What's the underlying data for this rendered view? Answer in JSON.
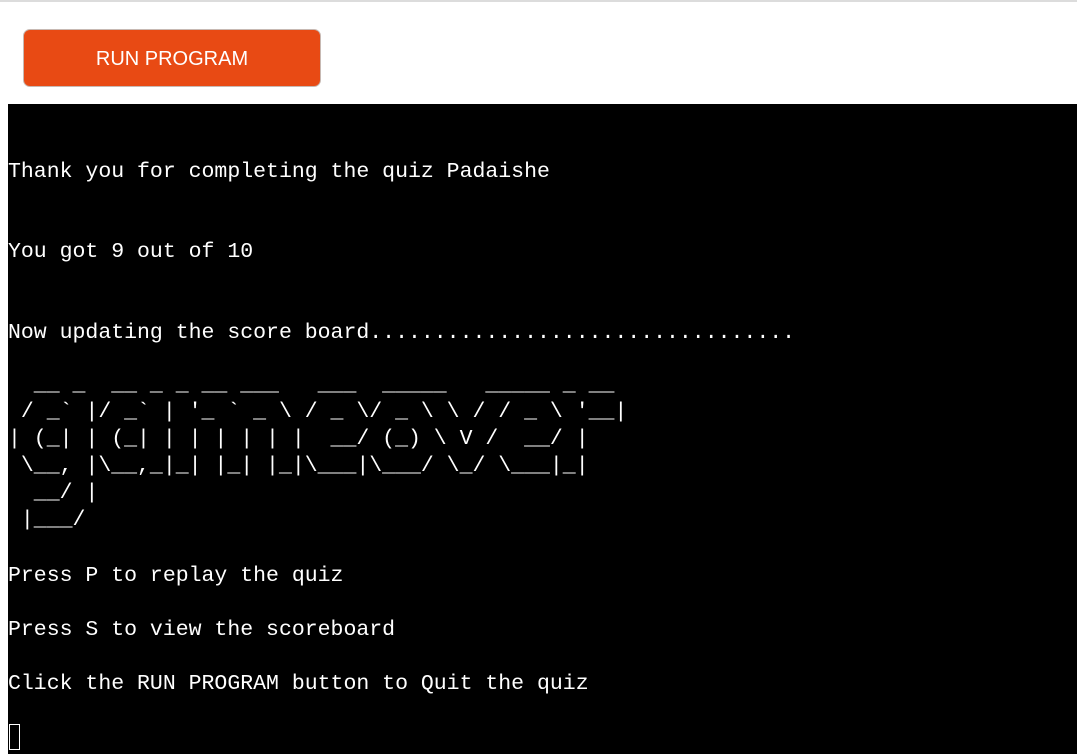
{
  "toolbar": {
    "run_label": "RUN PROGRAM"
  },
  "terminal": {
    "lines": [
      "Thank you for completing the quiz Padaishe",
      "You got 9 out of 10",
      "Now updating the score board................................."
    ],
    "ascii_art": "  __ _  __ _ _ __ ___   ___  _____   _____ _ __\n / _` |/ _` | '_ ` _ \\ / _ \\/ _ \\ \\ / / _ \\ '__|\n| (_| | (_| | | | | | |  __/ (_) \\ V /  __/ |\n \\__, |\\__,_|_| |_| |_|\\___|\\___/ \\_/ \\___|_|\n  __/ |\n |___/",
    "prompts": [
      "Press P to replay the quiz",
      "Press S to view the scoreboard",
      "Click the RUN PROGRAM button to Quit the quiz"
    ]
  },
  "colors": {
    "button_bg": "#e84a14",
    "terminal_bg": "#000000",
    "terminal_fg": "#ffffff"
  }
}
